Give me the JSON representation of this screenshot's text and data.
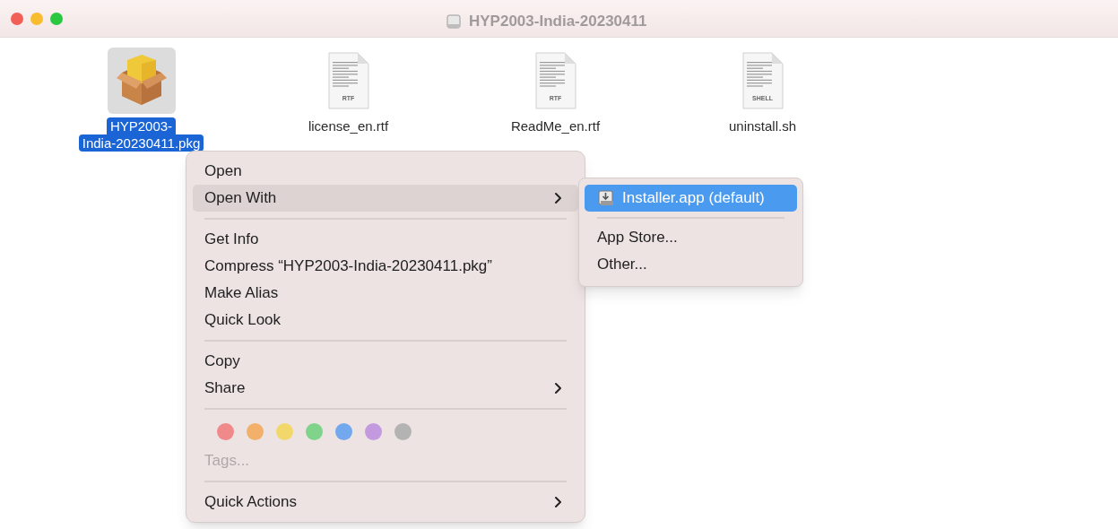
{
  "window": {
    "title": "HYP2003-India-20230411"
  },
  "files": [
    {
      "kind": "package",
      "name_lines": [
        "HYP2003-",
        "India-20230411.pkg"
      ],
      "selected": true
    },
    {
      "kind": "rtf",
      "badge": "RTF",
      "name_lines": [
        "license_en.rtf"
      ],
      "selected": false
    },
    {
      "kind": "rtf",
      "badge": "RTF",
      "name_lines": [
        "ReadMe_en.rtf"
      ],
      "selected": false
    },
    {
      "kind": "shell",
      "badge": "SHELL",
      "name_lines": [
        "uninstall.sh"
      ],
      "selected": false
    }
  ],
  "context_menu": {
    "items": [
      {
        "kind": "item",
        "label": "Open",
        "selected": false,
        "has_submenu": false,
        "disabled": false
      },
      {
        "kind": "item",
        "label": "Open With",
        "selected": true,
        "has_submenu": true,
        "disabled": false
      },
      {
        "kind": "separator"
      },
      {
        "kind": "item",
        "label": "Get Info",
        "selected": false,
        "has_submenu": false,
        "disabled": false
      },
      {
        "kind": "item",
        "label": "Compress “HYP2003-India-20230411.pkg”",
        "selected": false,
        "has_submenu": false,
        "disabled": false
      },
      {
        "kind": "item",
        "label": "Make Alias",
        "selected": false,
        "has_submenu": false,
        "disabled": false
      },
      {
        "kind": "item",
        "label": "Quick Look",
        "selected": false,
        "has_submenu": false,
        "disabled": false
      },
      {
        "kind": "separator"
      },
      {
        "kind": "item",
        "label": "Copy",
        "selected": false,
        "has_submenu": false,
        "disabled": false
      },
      {
        "kind": "item",
        "label": "Share",
        "selected": false,
        "has_submenu": true,
        "disabled": false
      },
      {
        "kind": "separator"
      },
      {
        "kind": "tag_colors",
        "colors": [
          {
            "color": "#f08a8a"
          },
          {
            "color": "#f2b06a"
          },
          {
            "color": "#f2d86a"
          },
          {
            "color": "#7fd38a"
          },
          {
            "color": "#72a8ee"
          },
          {
            "color": "#c39ae0"
          },
          {
            "color": "#b3b3b3"
          }
        ]
      },
      {
        "kind": "item",
        "label": "Tags...",
        "selected": false,
        "has_submenu": false,
        "disabled": true
      },
      {
        "kind": "separator"
      },
      {
        "kind": "item",
        "label": "Quick Actions",
        "selected": false,
        "has_submenu": true,
        "disabled": false
      }
    ]
  },
  "submenu": {
    "items": [
      {
        "kind": "item",
        "label": "Installer.app (default)",
        "icon": true,
        "selected": true
      },
      {
        "kind": "separator"
      },
      {
        "kind": "item",
        "label": "App Store...",
        "icon": false,
        "selected": false
      },
      {
        "kind": "item",
        "label": "Other...",
        "icon": false,
        "selected": false
      }
    ]
  }
}
